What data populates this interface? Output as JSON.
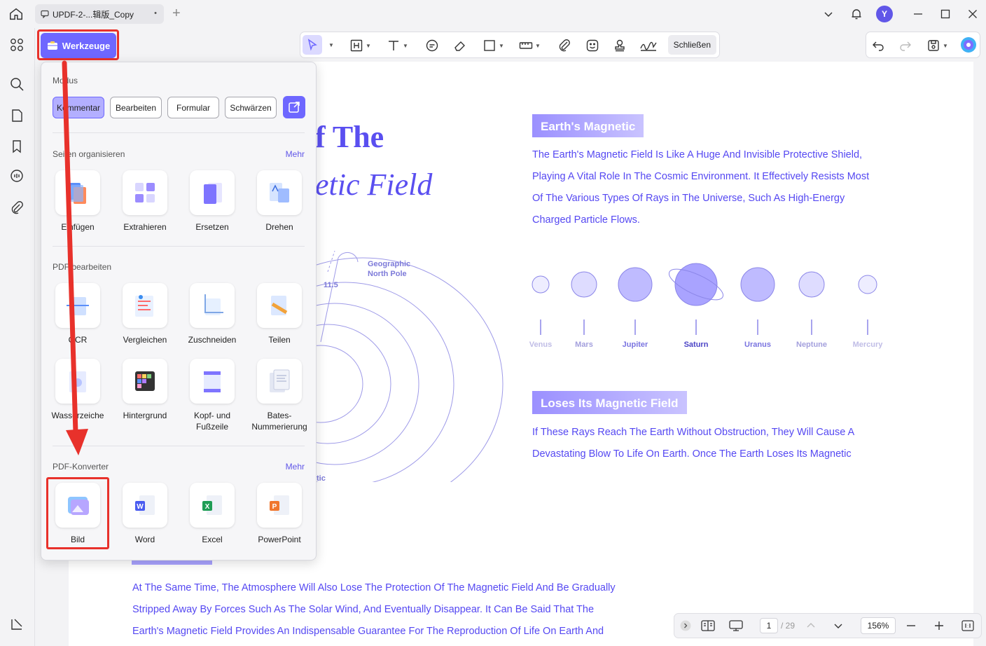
{
  "titlebar": {
    "tab_title": "UPDF-2-...辑版_Copy",
    "tab_close": "•",
    "tab_add": "+",
    "avatar_initial": "Y"
  },
  "toolbar": {
    "werkzeuge_label": "Werkzeuge",
    "close_label": "Schließen"
  },
  "panel": {
    "modus_title": "Modus",
    "modes": [
      "Kommentar",
      "Bearbeiten",
      "Formular",
      "Schwärzen"
    ],
    "organize_title": "Seiten organisieren",
    "organize_more": "Mehr",
    "organize_items": [
      "Einfügen",
      "Extrahieren",
      "Ersetzen",
      "Drehen"
    ],
    "edit_title": "PDF bearbeiten",
    "edit_items_row1": [
      "OCR",
      "Vergleichen",
      "Zuschneiden",
      "Teilen"
    ],
    "edit_items_row2": [
      "Wasserzeiche",
      "Hintergrund",
      "Kopf- und Fußzeile",
      "Bates-Nummerierung"
    ],
    "converter_title": "PDF-Konverter",
    "converter_more": "Mehr",
    "converter_items": [
      "Bild",
      "Word",
      "Excel",
      "PowerPoint"
    ]
  },
  "document": {
    "heading_line1_visible": "f The",
    "heading_line2_visible": "etic Field",
    "badge1": "Earth's Magnetic",
    "para1": [
      "The Earth's Magnetic Field Is Like A Huge And Invisible Protective Shield,",
      "Playing A Vital Role In The Cosmic Environment. It Effectively Resists Most",
      "Of The Various Types Of Rays in The Universe, Such As High-Energy",
      "Charged Particle Flows."
    ],
    "planets": [
      "Venus",
      "Mars",
      "Jupiter",
      "Saturn",
      "Uranus",
      "Neptune",
      "Mercury"
    ],
    "badge2": "Loses Its Magnetic Field",
    "para2": [
      "If These Rays Reach The Earth Without Obstruction, They Will Cause A",
      "Devastating Blow To Life On Earth. Once The Earth Loses Its Magnetic"
    ],
    "diagram_pole_label": "Geographic North Pole",
    "diagram_angle_label": "11.5",
    "diagram_partial_label": "tic",
    "para3": [
      "At The Same Time, The Atmosphere Will Also Lose The Protection Of The Magnetic Field And Be Gradually",
      "Stripped Away By Forces Such As The Solar Wind, And Eventually Disappear. It Can Be Said That The",
      "Earth's Magnetic Field Provides An Indispensable Guarantee For The Reproduction Of Life On Earth And"
    ]
  },
  "bottombar": {
    "page_current": "1",
    "page_total": "/ 29",
    "zoom": "156%"
  },
  "colors": {
    "accent": "#6e67ff",
    "highlight_red": "#e8312b",
    "doc_text": "#5548f2"
  }
}
